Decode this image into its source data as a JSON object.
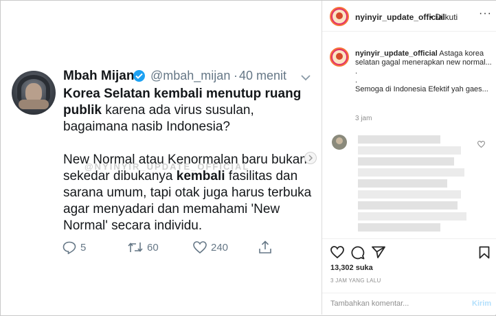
{
  "tweet": {
    "name": "Mbah Mijan",
    "handle": "@mbah_mijan",
    "separator": "·",
    "time": "40 menit",
    "p1_bold1": "Korea Selatan kembali menutup ruang",
    "p1_bold2": "publik",
    "p1_rest": " karena ada virus susulan, bagaimana nasib Indonesia?",
    "p2_a": "New Normal atau Kenormalan baru bukan sekedar dibukanya ",
    "p2_bold": "kembali",
    "p2_b": " fasilitas dan sarana umum, tapi otak juga harus terbuka agar menyadari dan memahami 'New Normal' secara individu.",
    "watermark": "@NYINYIR_UPDATE_OFFICIAL",
    "replies": "5",
    "retweets": "60",
    "likes": "240"
  },
  "instagram": {
    "username": "nyinyir_update_official",
    "follow_status": "• Diikuti",
    "caption_user": "nyinyir_update_official",
    "caption_text": "Astaga korea selatan gagal menerapkan new normal...",
    "caption_dot1": ".",
    "caption_dot2": ".",
    "caption_line2": "Semoga di Indonesia Efektif yah gaes...",
    "caption_time": "3 jam",
    "likes_count": "13,302 suka",
    "time_ago": "3 JAM YANG LALU",
    "comment_placeholder": "Tambahkan komentar...",
    "send_label": "Kirim",
    "more_label": "···"
  },
  "colors": {
    "twitter_blue": "#1da1f2",
    "ig_send_disabled": "#b2dffc"
  }
}
